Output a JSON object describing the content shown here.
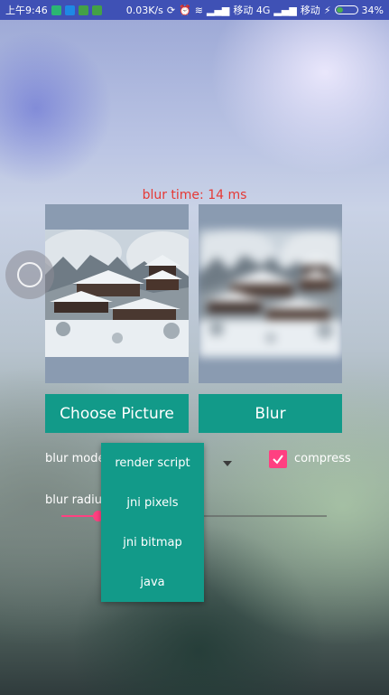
{
  "status_bar": {
    "time": "上午9:46",
    "net_speed": "0.03K/s",
    "carrier1": "移动 4G",
    "carrier2": "移动",
    "battery": "34%",
    "battery_level": 0.34,
    "bg_color": "#3f51b5"
  },
  "blur_time": "blur time: 14 ms",
  "buttons": {
    "choose": "Choose Picture",
    "blur": "Blur"
  },
  "blur_mode": {
    "label": "blur mode:",
    "options": [
      "render script",
      "jni pixels",
      "jni bitmap",
      "java"
    ]
  },
  "compress": {
    "label": "compress",
    "checked": true
  },
  "blur_radius": {
    "label": "blur radius",
    "progress": 0.14
  },
  "colors": {
    "accent": "#ff4081",
    "primary_button": "#129a89",
    "blur_time_text": "#e53935"
  }
}
